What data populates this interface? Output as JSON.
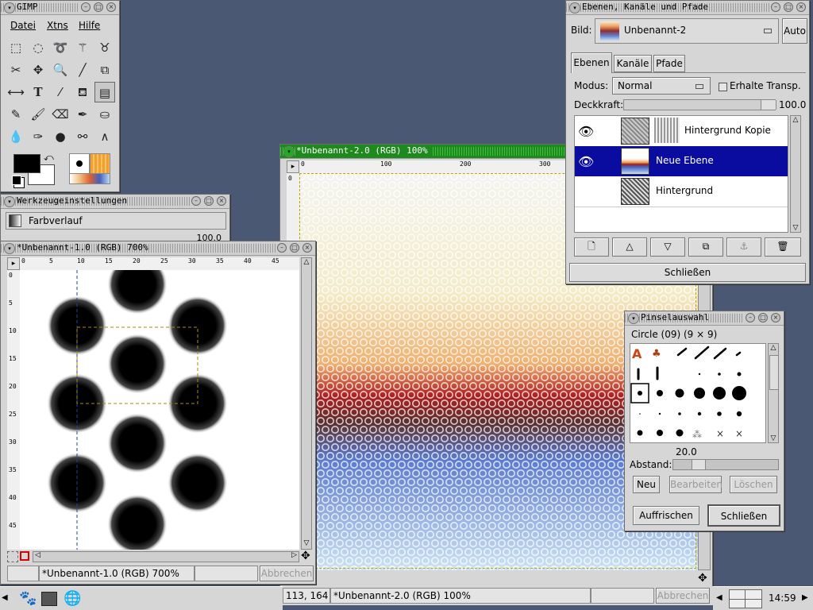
{
  "toolbox": {
    "title": "GIMP",
    "menu": [
      "Datei",
      "Xtns",
      "Hilfe"
    ],
    "tools": [
      "rect-select",
      "ellipse-select",
      "lasso",
      "fuzzy-select",
      "bezier",
      "scissors",
      "move",
      "zoom",
      "pencil-line",
      "crop",
      "flip",
      "text",
      "color-picker",
      "bucket",
      "gradient",
      "pencil",
      "paintbrush",
      "eraser",
      "airbrush",
      "clone",
      "smudge",
      "ink",
      "convolve",
      "dodge",
      "measure"
    ],
    "fg_color": "#000000",
    "bg_color": "#ffffff"
  },
  "tool_options": {
    "title": "Werkzeugeinstellungen",
    "tool_name": "Farbverlauf",
    "value": "100.0"
  },
  "image1": {
    "title": "*Unbenannt-1.0 (RGB) 700%",
    "ruler_labels": [
      "0",
      "5",
      "10",
      "15",
      "20",
      "25",
      "30",
      "35",
      "40",
      "45"
    ],
    "vruler_labels": [
      "0",
      "5",
      "10",
      "15",
      "20",
      "25",
      "30",
      "35",
      "40",
      "45"
    ],
    "status": "*Unbenannt-1.0 (RGB) 700%",
    "cancel": "Abbrechen"
  },
  "image2": {
    "title": "*Unbenannt-2.0 (RGB) 100%",
    "ruler_labels": [
      "0",
      "100",
      "200",
      "300"
    ],
    "vruler_labels": [
      "0"
    ],
    "coords": "113, 164",
    "status": "*Unbenannt-2.0 (RGB) 100%",
    "cancel": "Abbrechen"
  },
  "layers": {
    "title": "Ebenen, Kanäle und Pfade",
    "image_label": "Bild:",
    "image_value": "Unbenannt-2",
    "auto": "Auto",
    "tabs": [
      "Ebenen",
      "Kanäle",
      "Pfade"
    ],
    "mode_label": "Modus:",
    "mode_value": "Normal",
    "keep_trans": "Erhalte Transp.",
    "opacity_label": "Deckkraft:",
    "opacity_value": "100.0",
    "opacity": 1.0,
    "rows": [
      {
        "name": "Hintergrund Kopie",
        "visible": true
      },
      {
        "name": "Neue Ebene",
        "visible": true,
        "selected": true
      },
      {
        "name": "Hintergrund",
        "visible": false
      }
    ],
    "close": "Schließen"
  },
  "brushes": {
    "title": "Pinselauswahl",
    "brush_name": "Circle (09)  (9 × 9)",
    "spacing_value": "20.0",
    "spacing_label": "Abstand:",
    "spacing": 0.2,
    "btn_new": "Neu",
    "btn_edit": "Bearbeiten",
    "btn_delete": "Löschen",
    "btn_refresh": "Auffrischen",
    "btn_close": "Schließen"
  },
  "taskbar": {
    "clock": "14:59"
  },
  "colors": {
    "desktop": "#4b5873",
    "selection": "#0a0ca0"
  }
}
